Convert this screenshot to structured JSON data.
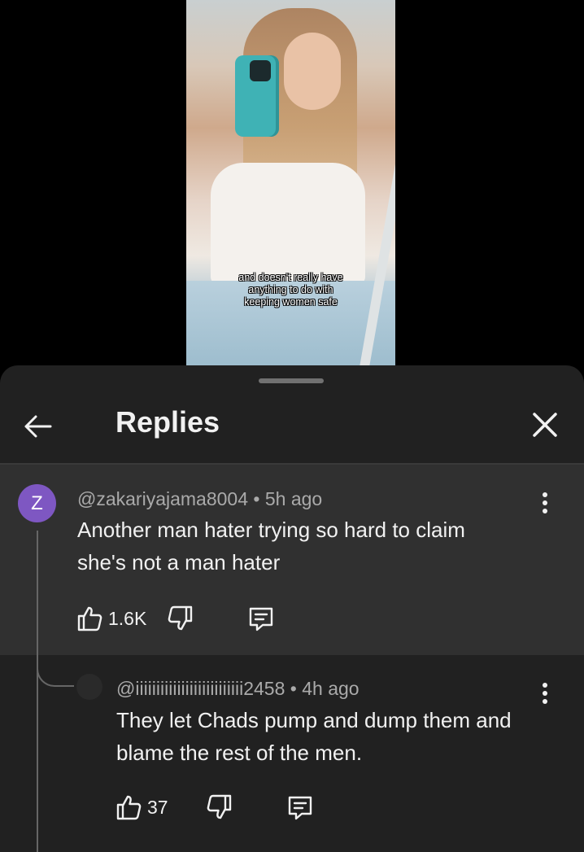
{
  "video": {
    "caption_lines": [
      "and doesn't really have",
      "anything to do with",
      "keeping women safe"
    ]
  },
  "sheet": {
    "title": "Replies",
    "back_icon": "arrow-left-icon",
    "close_icon": "close-icon"
  },
  "parent_comment": {
    "avatar_letter": "Z",
    "avatar_color": "#7e57c2",
    "author": "@zakariyajama8004",
    "separator": "•",
    "time": "5h ago",
    "text_line1": "Another man hater trying so hard to claim",
    "text_line2": "she's not a man hater",
    "likes": "1.6K"
  },
  "reply": {
    "author": "@iiiiiiiiiiiiiiiiiiiiiiiiii2458",
    "separator": "•",
    "time": "4h ago",
    "text_line1": "They let Chads pump and dump them and",
    "text_line2": "blame the rest of the men.",
    "likes": "37"
  },
  "colors": {
    "sheet_bg": "#212121",
    "highlight_bg": "#303030",
    "meta_text": "#aaaaaa"
  }
}
